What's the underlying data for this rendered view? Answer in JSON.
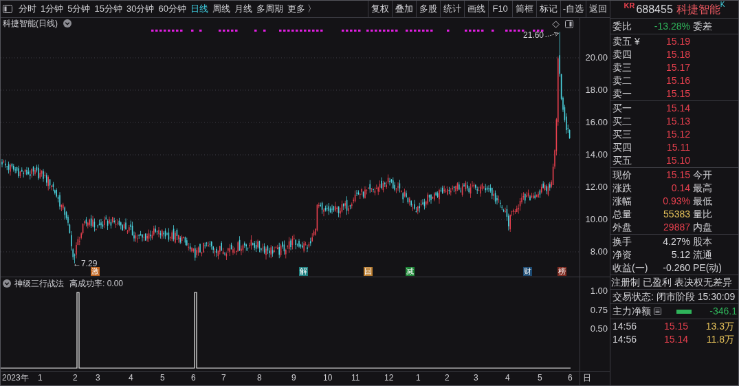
{
  "toolbar": {
    "period_tabs": [
      {
        "label": "分时",
        "selected": false
      },
      {
        "label": "1分钟",
        "selected": false
      },
      {
        "label": "5分钟",
        "selected": false
      },
      {
        "label": "15分钟",
        "selected": false
      },
      {
        "label": "30分钟",
        "selected": false
      },
      {
        "label": "60分钟",
        "selected": false
      },
      {
        "label": "日线",
        "selected": true
      },
      {
        "label": "周线",
        "selected": false
      },
      {
        "label": "月线",
        "selected": false
      },
      {
        "label": "多周期",
        "selected": false
      },
      {
        "label": "更多 〉",
        "selected": false
      }
    ],
    "buttons": [
      "复权",
      "叠加",
      "多股",
      "统计",
      "画线",
      "F10",
      "简框",
      "标记",
      "-自选",
      "返回"
    ]
  },
  "price_chart": {
    "title": "科捷智能(日线)",
    "axis_labels": [
      "20.00",
      "18.00",
      "16.00",
      "14.00",
      "12.00",
      "10.00",
      "8.00"
    ],
    "high_label": "21.60",
    "low_label": "←7.29",
    "event_markers": [
      {
        "label": "激",
        "color": "#c0641f"
      },
      {
        "label": "解",
        "color": "#1f7f80"
      },
      {
        "label": "回",
        "color": "#b97c2e"
      },
      {
        "label": "减",
        "color": "#1d8636"
      },
      {
        "label": "财",
        "color": "#1c4a72"
      },
      {
        "label": "榜",
        "color": "#7e2a20"
      }
    ]
  },
  "indicator_chart": {
    "name": "神级三行战法",
    "readout": "高成功率: 0.00",
    "axis_labels": [
      "1.00",
      "0.75",
      "0.50"
    ]
  },
  "time_axis": {
    "labels": [
      "2023年",
      "1",
      "2",
      "3",
      "4",
      "5",
      "6",
      "7",
      "8",
      "9",
      "10",
      "11",
      "12",
      "1",
      "2",
      "3",
      "4",
      "5",
      "6"
    ],
    "period": "日"
  },
  "quote_panel": {
    "market_tag": "KR",
    "code": "688455",
    "name": "科捷智能",
    "badge": "K",
    "order_ratio": {
      "label": "委比",
      "value": "-13.28%",
      "negative": true,
      "label_2": "委差"
    },
    "asks": [
      {
        "label": "卖五 ¥",
        "price": "15.19"
      },
      {
        "label": "卖四",
        "price": "15.18"
      },
      {
        "label": "卖三",
        "price": "15.17"
      },
      {
        "label": "卖二",
        "price": "15.16"
      },
      {
        "label": "卖一",
        "price": "15.15"
      }
    ],
    "bids": [
      {
        "label": "买一",
        "price": "15.14"
      },
      {
        "label": "买二",
        "price": "15.13"
      },
      {
        "label": "买三",
        "price": "15.12"
      },
      {
        "label": "买四",
        "price": "15.11"
      },
      {
        "label": "买五",
        "price": "15.10"
      }
    ],
    "stats": [
      {
        "label": "现价",
        "value": "15.15",
        "color": "#e8404e",
        "label_2": "今开"
      },
      {
        "label": "涨跌",
        "value": "0.14",
        "color": "#e8404e",
        "label_2": "最高"
      },
      {
        "label": "涨幅",
        "value": "0.93%",
        "color": "#e8404e",
        "label_2": "最低"
      },
      {
        "label": "总量",
        "value": "55383",
        "color": "#e6c25a",
        "label_2": "量比"
      },
      {
        "label": "外盘",
        "value": "29887",
        "color": "#e8404e",
        "label_2": "内盘"
      }
    ],
    "fundamentals": [
      {
        "label": "换手",
        "value": "4.27%",
        "label_2": "股本"
      },
      {
        "label": "净资",
        "value": "5.12",
        "label_2": "流通"
      },
      {
        "label": "收益(一)",
        "value": "-0.260",
        "label_2": "PE(动)"
      }
    ],
    "tags": "注册制 已盈利 表决权无差异",
    "trade_status": "交易状态: 闭市阶段 15:30:09",
    "main_net": {
      "label": "主力净额",
      "value": "-346.1",
      "negative": true
    },
    "trades": [
      {
        "time": "14:56",
        "price": "15.15",
        "volume": "13.3万"
      },
      {
        "time": "14:56",
        "price": "15.14",
        "volume": "11.8万"
      }
    ]
  }
}
